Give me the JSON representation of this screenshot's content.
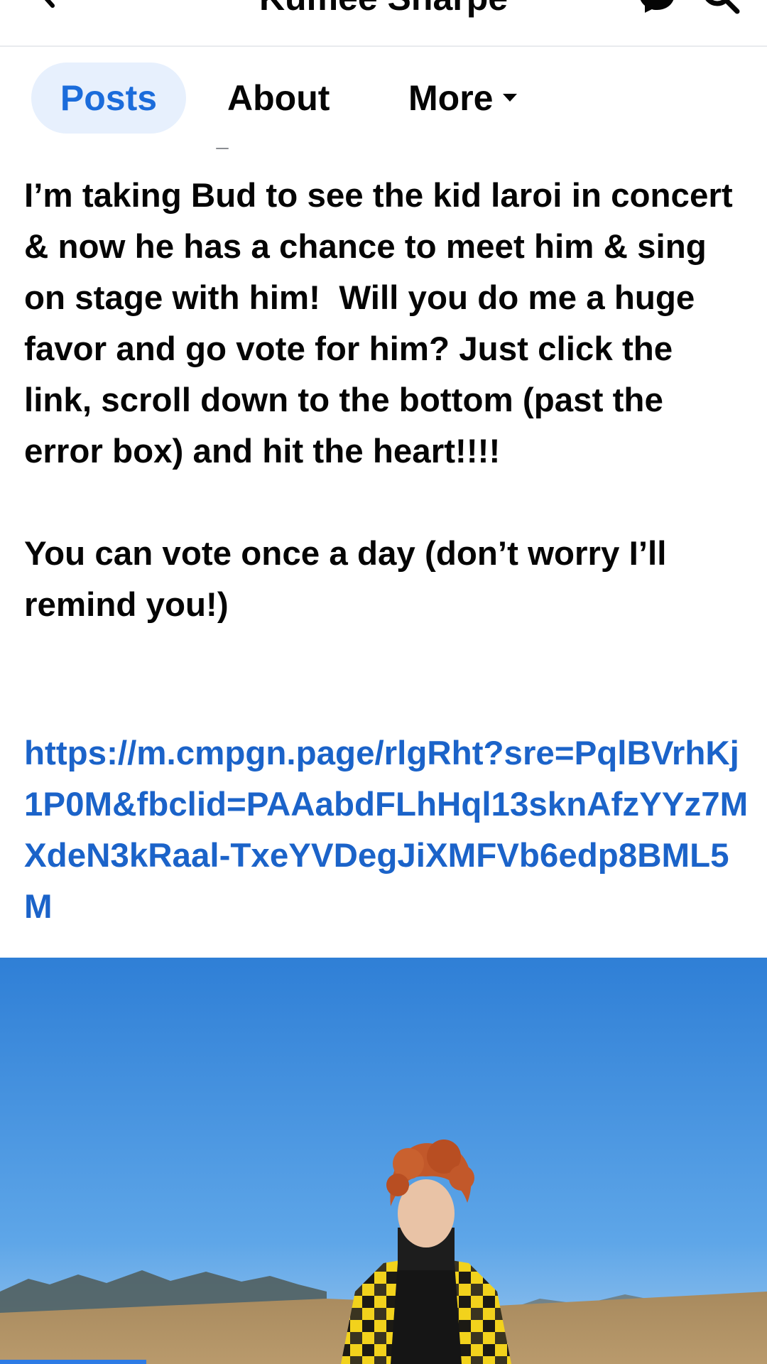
{
  "header": {
    "title": "Kumee Sharpe",
    "back_icon": "back-arrow-icon",
    "messenger_icon": "messenger-icon",
    "search_icon": "search-icon"
  },
  "tabs": [
    {
      "label": "Posts",
      "active": true
    },
    {
      "label": "About",
      "active": false
    },
    {
      "label": "More",
      "active": false
    }
  ],
  "post": {
    "text": "I’m taking Bud to see the kid laroi in concert & now he has a chance to meet him & sing on stage with him!  Will you do me a huge favor and go vote for him? Just click the link, scroll down to the bottom (past the error box) and hit the heart!!!!\n\nYou can vote once a day (don’t worry I’ll remind you!)",
    "link": "https://m.cmpgn.page/rlgRht?sre=PqlBVrhKj1P0M&fbclid=PAAabdFLhHql13sknAfzYYz7MXdeN3kRaal-TxeYVDegJiXMFVb6edp8BML5M",
    "photo_description_icon": "photo"
  },
  "colors": {
    "accent": "#1b6cdb",
    "tab_active_bg": "#e7f0fd",
    "link": "#1b63c9",
    "text": "#050505"
  }
}
